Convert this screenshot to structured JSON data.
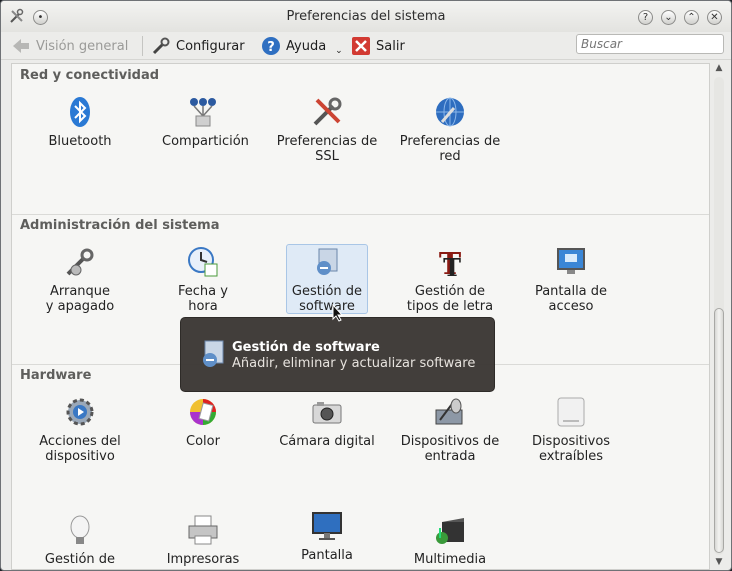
{
  "window": {
    "title": "Preferencias del sistema"
  },
  "toolbar": {
    "back_label": "Visión general",
    "configure_label": "Configurar",
    "help_label": "Ayuda",
    "quit_label": "Salir",
    "search_placeholder": "Buscar"
  },
  "groups": {
    "network": {
      "title": "Red y conectividad",
      "items": [
        {
          "label": "Bluetooth",
          "icon": "bluetooth-icon"
        },
        {
          "label": "Compartición",
          "icon": "sharing-icon"
        },
        {
          "label": "Preferencias de\nSSL",
          "icon": "tools-icon"
        },
        {
          "label": "Preferencias de\nred",
          "icon": "globe-icon"
        }
      ]
    },
    "admin": {
      "title": "Administración del sistema",
      "items": [
        {
          "label": "Arranque\ny apagado",
          "icon": "startup-wrench-icon"
        },
        {
          "label": "Fecha y hora",
          "icon": "clock-calendar-icon"
        },
        {
          "label": "Gestión de\nsoftware",
          "icon": "software-package-icon"
        },
        {
          "label": "Gestión de\ntipos de letra",
          "icon": "font-icon"
        },
        {
          "label": "Pantalla de\nacceso",
          "icon": "login-screen-icon"
        }
      ]
    },
    "hardware": {
      "title": "Hardware",
      "items": [
        {
          "label": "Acciones del\ndispositivo",
          "icon": "device-gear-icon"
        },
        {
          "label": "Color",
          "icon": "color-palette-icon"
        },
        {
          "label": "Cámara digital",
          "icon": "camera-icon"
        },
        {
          "label": "Dispositivos de\nentrada",
          "icon": "input-devices-icon"
        },
        {
          "label": "Dispositivos\nextraíbles",
          "icon": "removable-drive-icon"
        },
        {
          "label": "Gestión de",
          "icon": "power-bulb-icon"
        },
        {
          "label": "Impresoras",
          "icon": "printer-icon"
        },
        {
          "label": "Pantalla",
          "icon": "monitor-icon"
        },
        {
          "label": "Multimedia",
          "icon": "multimedia-icon"
        }
      ]
    }
  },
  "tooltip": {
    "title": "Gestión de software",
    "subtitle": "Añadir, eliminar y actualizar software"
  },
  "colors": {
    "accent": "#3b7fc4",
    "selection_bg": "#dfeaf6",
    "tooltip_bg": "#3a3633"
  }
}
